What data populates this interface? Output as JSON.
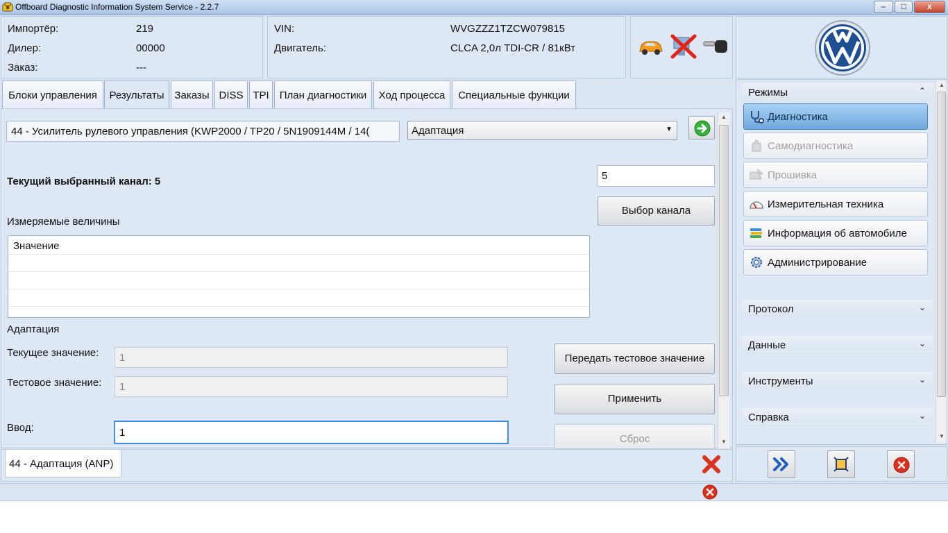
{
  "window": {
    "title": "Offboard Diagnostic Information System Service - 2.2.7",
    "buttons": {
      "minimize": "–",
      "maximize": "□",
      "close": "x"
    }
  },
  "info": {
    "importer_label": "Импортёр:",
    "importer_value": "219",
    "dealer_label": "Дилер:",
    "dealer_value": "00000",
    "order_label": "Заказ:",
    "order_value": "---",
    "vin_label": "VIN:",
    "vin_value": "WVGZZZ1TZCW079815",
    "engine_label": "Двигатель:",
    "engine_value": "CLCA 2,0л TDI-CR / 81кВт"
  },
  "tabs": [
    {
      "label": "Блоки управления"
    },
    {
      "label": "Результаты"
    },
    {
      "label": "Заказы"
    },
    {
      "label": "DISS"
    },
    {
      "label": "TPI"
    },
    {
      "label": "План диагностики"
    },
    {
      "label": "Ход процесса"
    },
    {
      "label": "Специальные функции"
    }
  ],
  "main": {
    "control_unit": "44 - Усилитель рулевого управления  (KWP2000 / TP20 / 5N1909144M   / 14(",
    "function_select": "Адаптация",
    "current_channel_text": "Текущий выбранный канал: 5",
    "channel_input": "5",
    "channel_button": "Выбор канала",
    "measured_label": "Измеряемые величины",
    "table_header": "Значение",
    "adaptation_label": "Адаптация",
    "current_value_label": "Текущее значение:",
    "current_value": "1",
    "test_value_label": "Тестовое значение:",
    "test_value": "1",
    "input_label": "Ввод:",
    "input_value": "1",
    "send_test_button": "Передать тестовое значение",
    "apply_button": "Применить",
    "reset_button": "Сброс",
    "bottom_tab": "44 - Адаптация (ANP)"
  },
  "sidebar": {
    "modes_header": "Режимы",
    "items": [
      {
        "label": "Диагностика",
        "icon": "stethoscope-icon"
      },
      {
        "label": "Самодиагностика",
        "icon": "hand-icon"
      },
      {
        "label": "Прошивка",
        "icon": "flash-icon"
      },
      {
        "label": "Измерительная техника",
        "icon": "gauge-icon"
      },
      {
        "label": "Информация об автомобиле",
        "icon": "books-icon"
      },
      {
        "label": "Администрирование",
        "icon": "gear-icon"
      }
    ],
    "sections": [
      {
        "label": "Протокол"
      },
      {
        "label": "Данные"
      },
      {
        "label": "Инструменты"
      },
      {
        "label": "Справка"
      }
    ]
  },
  "colors": {
    "panel": "#dde8f4",
    "selected": "#6fa8dc",
    "error_red": "#d9321f"
  }
}
